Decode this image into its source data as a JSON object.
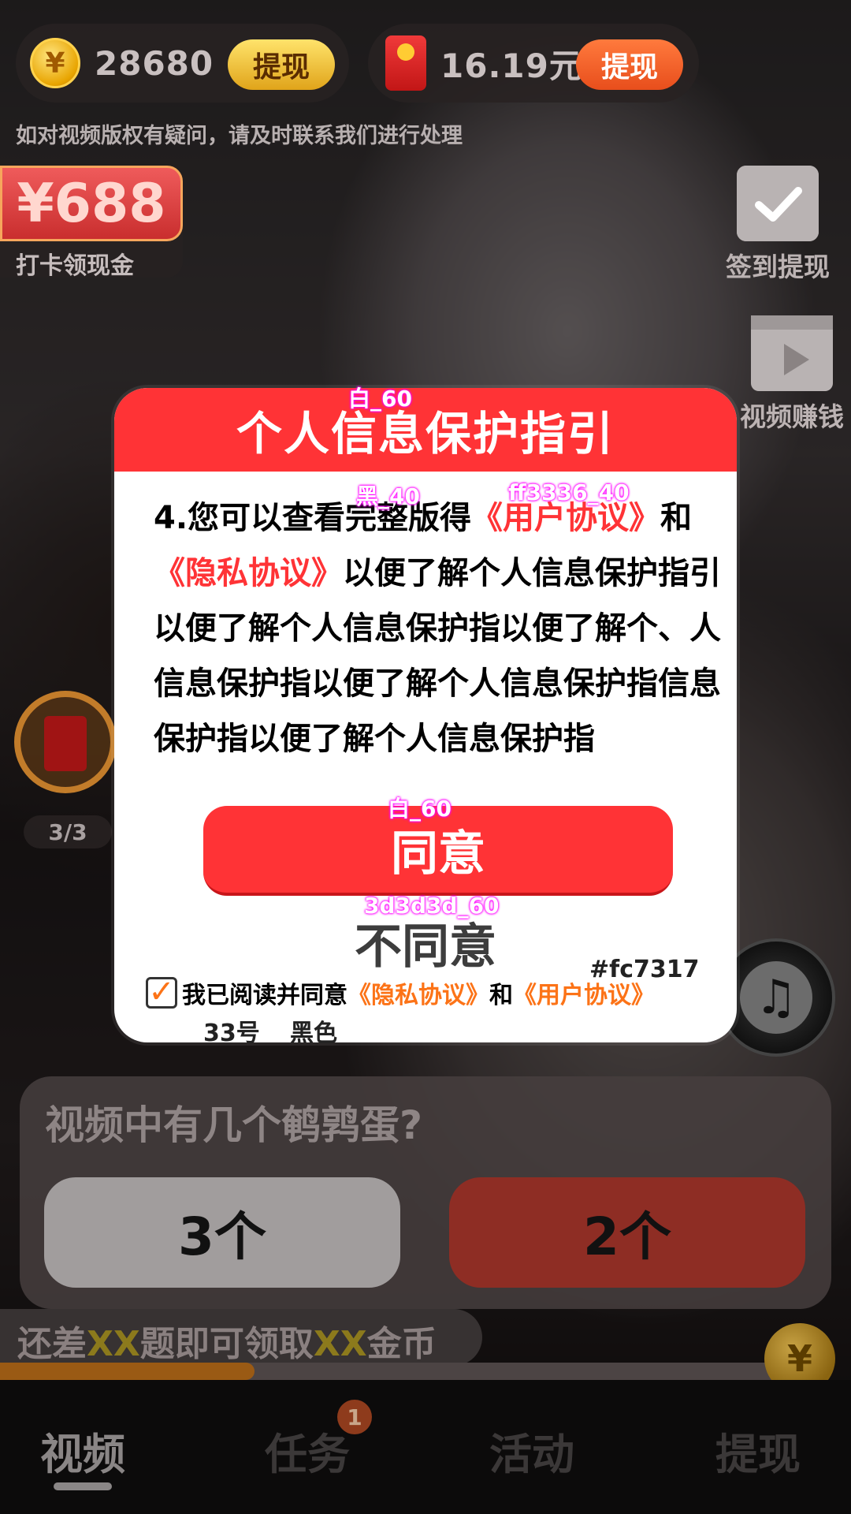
{
  "top_bar": {
    "coins": "28680",
    "coin_withdraw_label": "提现",
    "cash": "16.19元",
    "cash_withdraw_label": "提现",
    "coin_symbol": "¥"
  },
  "copyright_notice": "如对视频版权有疑问，请及时联系我们进行处理",
  "checkin": {
    "amount": "¥688",
    "label": "打卡领现金"
  },
  "side_actions": [
    {
      "label": "签到提现",
      "icon": "calendar-check-icon"
    },
    {
      "label": "视频赚钱",
      "icon": "video-play-icon"
    }
  ],
  "float_redpacket": {
    "progress": "3/3",
    "icon": "red-envelope-icon"
  },
  "modal": {
    "title": "个人信息保护指引",
    "body_prefix": "4.您可以查看完整版得",
    "link_user_agreement": "《用户协议》",
    "body_and": "和",
    "link_privacy": "《隐私协议》",
    "body_rest": "以便了解个人信息保护指引以便了解个人信息保护指以便了解个、人信息保护指以便了解个人信息保护指信息保护指以便了解个人信息保护指",
    "agree_label": "同意",
    "disagree_label": "不同意",
    "consent_prefix": "我已阅读并同意",
    "consent_privacy": "《隐私协议》",
    "consent_and": "和",
    "consent_user": "《用户协议》",
    "checkbox_mark": "✓"
  },
  "annotations": {
    "title_spec": "白_60",
    "body_spec": "黑_40",
    "link_spec": "ff3336_40",
    "agree_spec": "白_60",
    "disagree_spec": "3d3d3d_60",
    "consent_link_color": "#fc7317",
    "consent_size": "33号",
    "consent_color": "黑色"
  },
  "question": {
    "text": "视频中有几个鹌鹑蛋?",
    "option_a": "3个",
    "option_b": "2个"
  },
  "goal": {
    "prefix": "还差",
    "xx1": "XX",
    "middle": "题即可领取",
    "xx2": "XX",
    "suffix": "金币",
    "progress_fraction": 0.33
  },
  "nav": {
    "items": [
      "视频",
      "任务",
      "活动",
      "提现"
    ],
    "active_index": 0,
    "task_badge": "1"
  },
  "music_icon": "music-note-icon",
  "colors": {
    "brand_red": "#ff3336",
    "link_orange": "#fc7317",
    "disagree_gray": "#3d3d3d"
  }
}
